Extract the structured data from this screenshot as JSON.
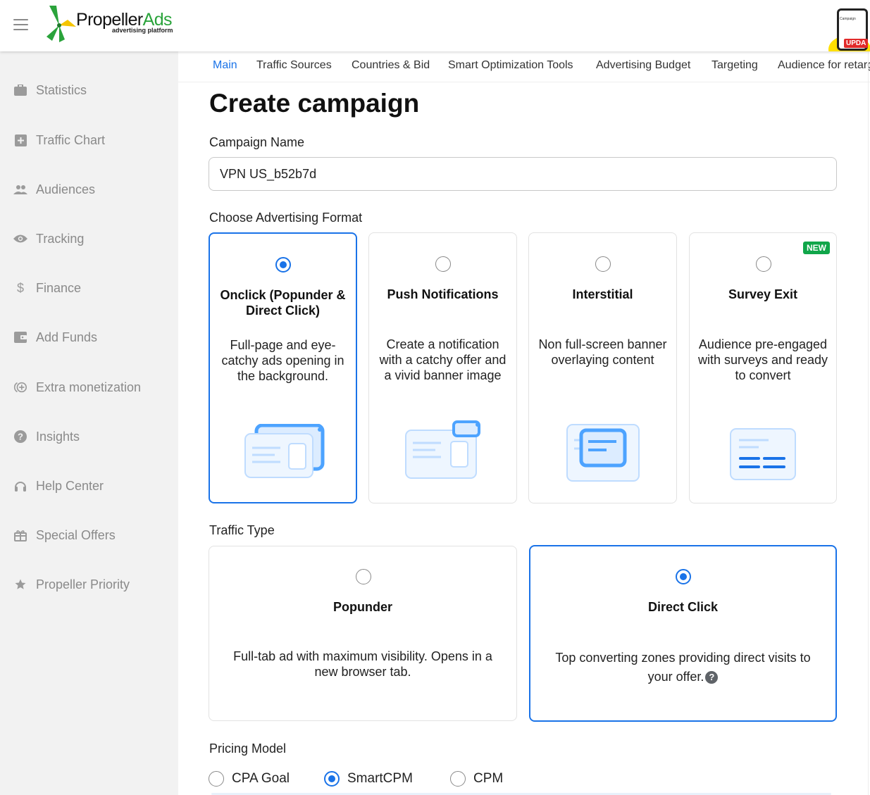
{
  "brand": {
    "name_part1": "Propeller",
    "name_part2": "Ads",
    "tagline": "advertising platform",
    "promo_badge": "UPDA",
    "promo_screen_text": "Campaign"
  },
  "colors": {
    "accent": "#1a73e8",
    "badge_green": "#10a64a",
    "sidebar_bg": "#f2f2f2",
    "logo_green": "#2aa33b",
    "logo_yellow": "#f5c400",
    "illustration_blue": "#4da3ff"
  },
  "sidebar": {
    "items": [
      {
        "label": "Statistics",
        "icon": "briefcase-icon"
      },
      {
        "label": "Traffic Chart",
        "icon": "chart-icon"
      },
      {
        "label": "Audiences",
        "icon": "people-icon"
      },
      {
        "label": "Tracking",
        "icon": "eye-icon"
      },
      {
        "label": "Finance",
        "icon": "dollar-icon"
      },
      {
        "label": "Add Funds",
        "icon": "wallet-icon"
      },
      {
        "label": "Extra monetization",
        "icon": "monetization-icon"
      },
      {
        "label": "Insights",
        "icon": "question-icon"
      },
      {
        "label": "Help Center",
        "icon": "headset-icon"
      },
      {
        "label": "Special Offers",
        "icon": "gift-icon"
      },
      {
        "label": "Propeller Priority",
        "icon": "star-icon"
      }
    ]
  },
  "tabs": [
    {
      "label": "Main",
      "active": true
    },
    {
      "label": "Traffic Sources",
      "active": false
    },
    {
      "label": "Countries & Bid",
      "active": false
    },
    {
      "label": "Smart Optimization Tools",
      "active": false
    },
    {
      "label": "Advertising Budget",
      "active": false
    },
    {
      "label": "Targeting",
      "active": false
    },
    {
      "label": "Audience for retargeting",
      "active": false
    }
  ],
  "form": {
    "title": "Create campaign",
    "campaign_name_label": "Campaign Name",
    "campaign_name_value": "VPN US_b52b7d",
    "format_label": "Choose Advertising Format",
    "formats": [
      {
        "title": "Onclick (Popunder & Direct Click)",
        "desc": "Full-page and eye-catchy ads opening in the background.",
        "selected": true,
        "badge": ""
      },
      {
        "title": "Push Notifications",
        "desc": "Create a notification with a catchy offer and a vivid banner image",
        "selected": false,
        "badge": ""
      },
      {
        "title": "Interstitial",
        "desc": "Non full-screen banner overlaying content",
        "selected": false,
        "badge": ""
      },
      {
        "title": "Survey Exit",
        "desc": "Audience pre-engaged with surveys and ready to convert",
        "selected": false,
        "badge": "NEW"
      }
    ],
    "traffic_label": "Traffic Type",
    "traffic_types": [
      {
        "title": "Popunder",
        "desc": "Full-tab ad with maximum visibility. Opens in a new browser tab.",
        "selected": false
      },
      {
        "title": "Direct Click",
        "desc": "Top converting zones providing direct visits to your offer.",
        "selected": true,
        "help": "?"
      }
    ],
    "pricing_label": "Pricing Model",
    "pricing_options": [
      {
        "label": "CPA Goal",
        "selected": false
      },
      {
        "label": "SmartCPM",
        "selected": true
      },
      {
        "label": "CPM",
        "selected": false
      }
    ]
  }
}
